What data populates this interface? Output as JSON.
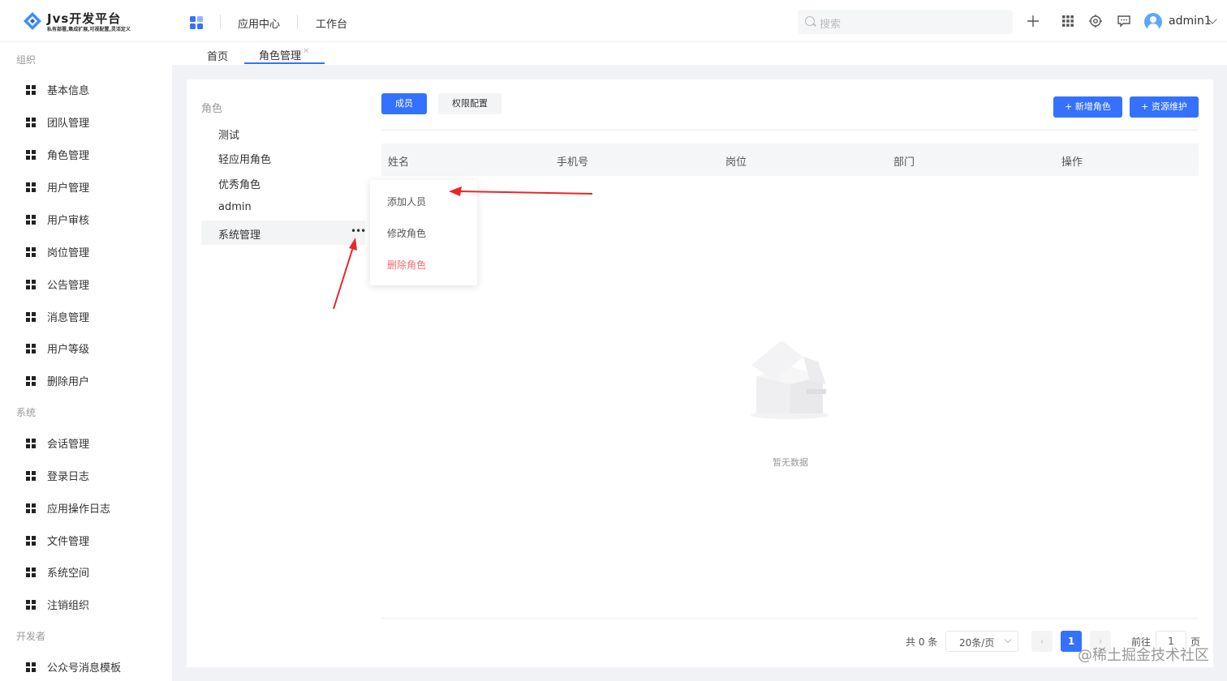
{
  "app": {
    "logo_title": "Jvs开发平台",
    "logo_subtitle": "私有部署,集成扩展,可视配置,灵活定义"
  },
  "header": {
    "nav": [
      "应用中心",
      "工作台"
    ],
    "search_placeholder": "搜索",
    "user_name": "admin1"
  },
  "sidebar": {
    "groups": [
      {
        "title": "组织",
        "items": [
          "基本信息",
          "团队管理",
          "角色管理",
          "用户管理",
          "用户审核",
          "岗位管理",
          "公告管理",
          "消息管理",
          "用户等级",
          "删除用户"
        ]
      },
      {
        "title": "系统",
        "items": [
          "会话管理",
          "登录日志",
          "应用操作日志",
          "文件管理",
          "系统空间",
          "注销组织"
        ]
      },
      {
        "title": "开发者",
        "items": [
          "公众号消息模板"
        ]
      }
    ]
  },
  "tabs": {
    "home": "首页",
    "current": "角色管理"
  },
  "roles": {
    "header": "角色",
    "items": [
      "测试",
      "轻应用角色",
      "优秀角色",
      "admin",
      "系统管理"
    ]
  },
  "toolbar": {
    "members": "成员",
    "permissions": "权限配置",
    "add_role": "+ 新增角色",
    "resource": "+ 资源维护"
  },
  "table": {
    "columns": [
      "姓名",
      "手机号",
      "岗位",
      "部门",
      "操作"
    ],
    "empty_text": "暂无数据"
  },
  "context_menu": {
    "add_member": "添加人员",
    "edit_role": "修改角色",
    "delete_role": "删除角色"
  },
  "pagination": {
    "total": "共 0 条",
    "page_size": "20条/页",
    "current_page": "1",
    "goto_label": "前往",
    "goto_value": "1",
    "page_suffix": "页"
  },
  "watermark": "@稀土掘金技术社区",
  "colors": {
    "primary": "#3471ff",
    "danger": "#f56c6c",
    "annotation": "#e8262a"
  }
}
